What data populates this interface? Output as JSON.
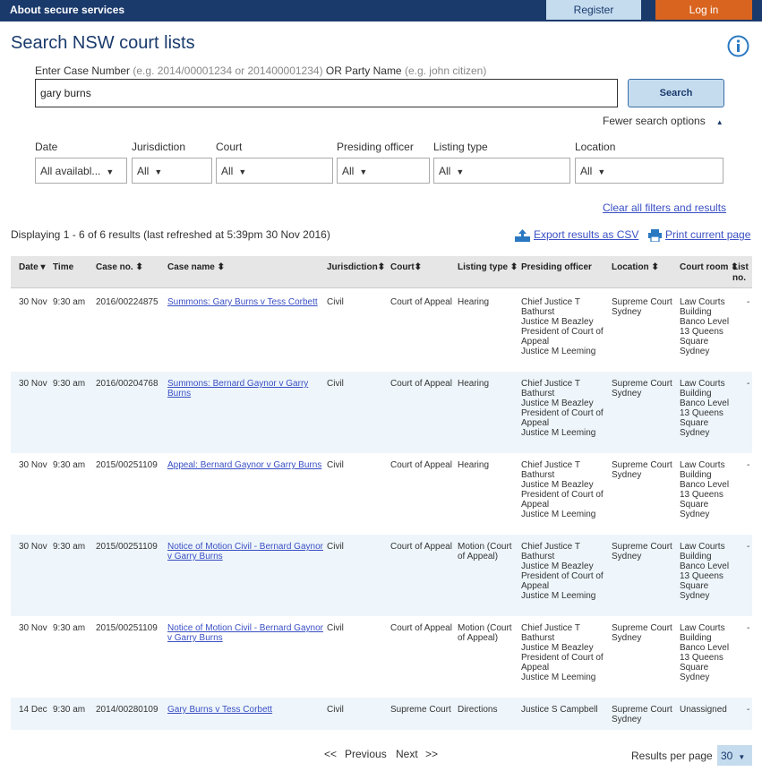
{
  "header": {
    "about": "About secure services",
    "register": "Register",
    "login": "Log in"
  },
  "page": {
    "title": "Search NSW court lists"
  },
  "search": {
    "label_main": "Enter Case Number",
    "label_hint1": "(e.g. 2014/00001234 or 201400001234)",
    "label_or": "OR Party Name",
    "label_hint2": "(e.g. john citizen)",
    "value": "gary burns",
    "button": "Search",
    "fewer_options": "Fewer search options"
  },
  "filters": {
    "date": {
      "label": "Date",
      "value": "All availabl..."
    },
    "jurisdiction": {
      "label": "Jurisdiction",
      "value": "All"
    },
    "court": {
      "label": "Court",
      "value": "All"
    },
    "presiding": {
      "label": "Presiding officer",
      "value": "All"
    },
    "listing": {
      "label": "Listing type",
      "value": "All"
    },
    "location": {
      "label": "Location",
      "value": "All"
    },
    "clear": "Clear all filters and results"
  },
  "results": {
    "summary": "Displaying 1 - 6 of 6 results (last refreshed at 5:39pm 30 Nov 2016)",
    "export": "Export results as CSV",
    "print": "Print current page"
  },
  "table": {
    "headers": {
      "date": "Date",
      "time": "Time",
      "case_no": "Case no.",
      "case_name": "Case name",
      "jurisdiction": "Jurisdiction",
      "court": "Court",
      "listing_type": "Listing type",
      "presiding": "Presiding officer",
      "location": "Location",
      "court_room": "Court room",
      "list_no_1": "List",
      "list_no_2": "no."
    },
    "rows": [
      {
        "date": "30 Nov",
        "time": "9:30 am",
        "case_no": "2016/00224875",
        "case_name": "Summons: Gary Burns v Tess Corbett",
        "jurisdiction": "Civil",
        "court": "Court of Appeal",
        "listing_type": "Hearing",
        "presiding": [
          "Chief Justice T Bathurst",
          "Justice M Beazley",
          "President of Court of Appeal",
          "Justice M Leeming"
        ],
        "location": "Supreme Court Sydney",
        "court_room": "Law Courts Building Banco Level 13 Queens Square Sydney",
        "list_no": "-"
      },
      {
        "date": "30 Nov",
        "time": "9:30 am",
        "case_no": "2016/00204768",
        "case_name": "Summons: Bernard Gaynor v Garry Burns",
        "jurisdiction": "Civil",
        "court": "Court of Appeal",
        "listing_type": "Hearing",
        "presiding": [
          "Chief Justice T Bathurst",
          "Justice M Beazley",
          "President of Court of Appeal",
          "Justice M Leeming"
        ],
        "location": "Supreme Court Sydney",
        "court_room": "Law Courts Building Banco Level 13 Queens Square Sydney",
        "list_no": "-"
      },
      {
        "date": "30 Nov",
        "time": "9:30 am",
        "case_no": "2015/00251109",
        "case_name": "Appeal: Bernard Gaynor v Garry Burns",
        "jurisdiction": "Civil",
        "court": "Court of Appeal",
        "listing_type": "Hearing",
        "presiding": [
          "Chief Justice T Bathurst",
          "Justice M Beazley",
          "President of Court of Appeal",
          "Justice M Leeming"
        ],
        "location": "Supreme Court Sydney",
        "court_room": "Law Courts Building Banco Level 13 Queens Square Sydney",
        "list_no": "-"
      },
      {
        "date": "30 Nov",
        "time": "9:30 am",
        "case_no": "2015/00251109",
        "case_name": "Notice of Motion Civil - Bernard Gaynor v Garry Burns",
        "jurisdiction": "Civil",
        "court": "Court of Appeal",
        "listing_type": "Motion (Court of Appeal)",
        "presiding": [
          "Chief Justice T Bathurst",
          "Justice M Beazley",
          "President of Court of Appeal",
          "Justice M Leeming"
        ],
        "location": "Supreme Court Sydney",
        "court_room": "Law Courts Building Banco Level 13 Queens Square Sydney",
        "list_no": "-"
      },
      {
        "date": "30 Nov",
        "time": "9:30 am",
        "case_no": "2015/00251109",
        "case_name": "Notice of Motion Civil - Bernard Gaynor v Garry Burns",
        "jurisdiction": "Civil",
        "court": "Court of Appeal",
        "listing_type": "Motion (Court of Appeal)",
        "presiding": [
          "Chief Justice T Bathurst",
          "Justice M Beazley",
          "President of Court of Appeal",
          "Justice M Leeming"
        ],
        "location": "Supreme Court Sydney",
        "court_room": "Law Courts Building Banco Level 13 Queens Square Sydney",
        "list_no": "-"
      },
      {
        "date": "14 Dec",
        "time": "9:30 am",
        "case_no": "2014/00280109",
        "case_name": "Gary Burns v Tess Corbett",
        "jurisdiction": "Civil",
        "court": "Supreme Court",
        "listing_type": "Directions",
        "presiding": [
          "Justice S Campbell"
        ],
        "location": "Supreme Court Sydney",
        "court_room": "Unassigned",
        "list_no": "-"
      }
    ]
  },
  "pagination": {
    "first": "<<",
    "previous": "Previous",
    "next": "Next",
    "last": ">>",
    "rpp_label": "Results per page",
    "rpp_value": "30"
  },
  "colors": {
    "navy": "#1a3a6c",
    "login": "#d9641f",
    "light_blue": "#c5dcef",
    "link": "#3a4fc4",
    "row_alt": "#eef6fb"
  }
}
